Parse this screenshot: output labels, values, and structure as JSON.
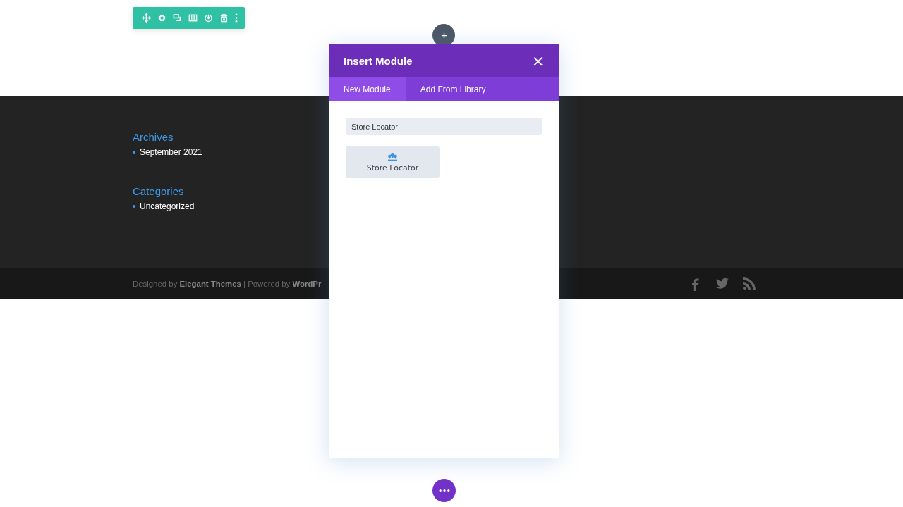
{
  "footer": {
    "widgets": [
      {
        "title": "Archives",
        "items": [
          "September 2021"
        ]
      },
      {
        "title": "Categories",
        "items": [
          "Uncategorized"
        ]
      }
    ],
    "credits": "Designed by **Elegant Themes** | Powered by **WordPr**"
  },
  "modal": {
    "title": "Insert Module",
    "close": "×",
    "tabs": [
      {
        "label": "New Module",
        "selected": true
      },
      {
        "label": "Add From Library",
        "selected": false
      }
    ],
    "search": {
      "value": "Store Locator"
    },
    "modules": [
      {
        "label": "Store Locator"
      }
    ]
  }
}
